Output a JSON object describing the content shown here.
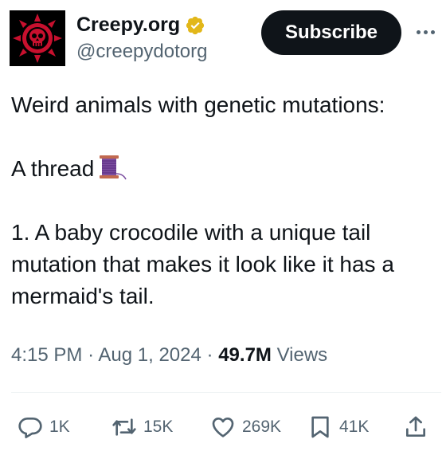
{
  "author": {
    "display_name": "Creepy.org",
    "handle": "@creepydotorg",
    "verified_badge": "gold-checkmark-icon",
    "avatar": "red-skull-logo"
  },
  "header": {
    "subscribe_label": "Subscribe",
    "more_icon": "more-dots-icon"
  },
  "tweet": {
    "lines": [
      "Weird animals with genetic mutations:",
      "",
      "A thread",
      "",
      "1. A baby crocodile with a unique tail",
      "mutation that makes it look like it has a",
      "mermaid's tail."
    ],
    "emoji": "spool-of-thread-emoji"
  },
  "meta": {
    "time": "4:15 PM",
    "separator": "·",
    "date": "Aug 1, 2024",
    "views_count": "49.7M",
    "views_label": "Views"
  },
  "actions": {
    "replies": "1K",
    "reposts": "15K",
    "likes": "269K",
    "bookmarks": "41K"
  },
  "colors": {
    "text": "#0f1419",
    "secondary": "#536471",
    "button_bg": "#0f1419",
    "verified": "#e2b719",
    "divider": "#eff3f4"
  }
}
